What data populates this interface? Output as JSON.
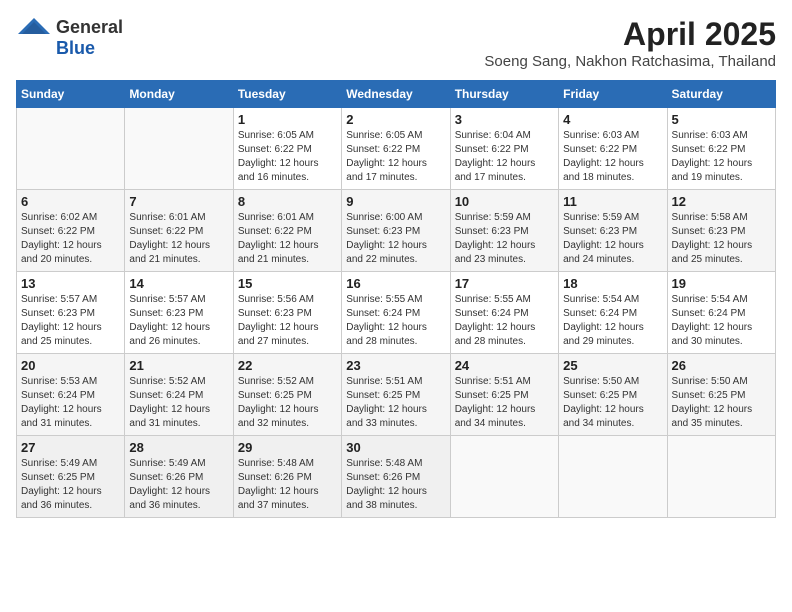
{
  "header": {
    "logo_general": "General",
    "logo_blue": "Blue",
    "month": "April 2025",
    "location": "Soeng Sang, Nakhon Ratchasima, Thailand"
  },
  "weekdays": [
    "Sunday",
    "Monday",
    "Tuesday",
    "Wednesday",
    "Thursday",
    "Friday",
    "Saturday"
  ],
  "weeks": [
    [
      {
        "day": "",
        "info": ""
      },
      {
        "day": "",
        "info": ""
      },
      {
        "day": "1",
        "info": "Sunrise: 6:05 AM\nSunset: 6:22 PM\nDaylight: 12 hours and 16 minutes."
      },
      {
        "day": "2",
        "info": "Sunrise: 6:05 AM\nSunset: 6:22 PM\nDaylight: 12 hours and 17 minutes."
      },
      {
        "day": "3",
        "info": "Sunrise: 6:04 AM\nSunset: 6:22 PM\nDaylight: 12 hours and 17 minutes."
      },
      {
        "day": "4",
        "info": "Sunrise: 6:03 AM\nSunset: 6:22 PM\nDaylight: 12 hours and 18 minutes."
      },
      {
        "day": "5",
        "info": "Sunrise: 6:03 AM\nSunset: 6:22 PM\nDaylight: 12 hours and 19 minutes."
      }
    ],
    [
      {
        "day": "6",
        "info": "Sunrise: 6:02 AM\nSunset: 6:22 PM\nDaylight: 12 hours and 20 minutes."
      },
      {
        "day": "7",
        "info": "Sunrise: 6:01 AM\nSunset: 6:22 PM\nDaylight: 12 hours and 21 minutes."
      },
      {
        "day": "8",
        "info": "Sunrise: 6:01 AM\nSunset: 6:22 PM\nDaylight: 12 hours and 21 minutes."
      },
      {
        "day": "9",
        "info": "Sunrise: 6:00 AM\nSunset: 6:23 PM\nDaylight: 12 hours and 22 minutes."
      },
      {
        "day": "10",
        "info": "Sunrise: 5:59 AM\nSunset: 6:23 PM\nDaylight: 12 hours and 23 minutes."
      },
      {
        "day": "11",
        "info": "Sunrise: 5:59 AM\nSunset: 6:23 PM\nDaylight: 12 hours and 24 minutes."
      },
      {
        "day": "12",
        "info": "Sunrise: 5:58 AM\nSunset: 6:23 PM\nDaylight: 12 hours and 25 minutes."
      }
    ],
    [
      {
        "day": "13",
        "info": "Sunrise: 5:57 AM\nSunset: 6:23 PM\nDaylight: 12 hours and 25 minutes."
      },
      {
        "day": "14",
        "info": "Sunrise: 5:57 AM\nSunset: 6:23 PM\nDaylight: 12 hours and 26 minutes."
      },
      {
        "day": "15",
        "info": "Sunrise: 5:56 AM\nSunset: 6:23 PM\nDaylight: 12 hours and 27 minutes."
      },
      {
        "day": "16",
        "info": "Sunrise: 5:55 AM\nSunset: 6:24 PM\nDaylight: 12 hours and 28 minutes."
      },
      {
        "day": "17",
        "info": "Sunrise: 5:55 AM\nSunset: 6:24 PM\nDaylight: 12 hours and 28 minutes."
      },
      {
        "day": "18",
        "info": "Sunrise: 5:54 AM\nSunset: 6:24 PM\nDaylight: 12 hours and 29 minutes."
      },
      {
        "day": "19",
        "info": "Sunrise: 5:54 AM\nSunset: 6:24 PM\nDaylight: 12 hours and 30 minutes."
      }
    ],
    [
      {
        "day": "20",
        "info": "Sunrise: 5:53 AM\nSunset: 6:24 PM\nDaylight: 12 hours and 31 minutes."
      },
      {
        "day": "21",
        "info": "Sunrise: 5:52 AM\nSunset: 6:24 PM\nDaylight: 12 hours and 31 minutes."
      },
      {
        "day": "22",
        "info": "Sunrise: 5:52 AM\nSunset: 6:25 PM\nDaylight: 12 hours and 32 minutes."
      },
      {
        "day": "23",
        "info": "Sunrise: 5:51 AM\nSunset: 6:25 PM\nDaylight: 12 hours and 33 minutes."
      },
      {
        "day": "24",
        "info": "Sunrise: 5:51 AM\nSunset: 6:25 PM\nDaylight: 12 hours and 34 minutes."
      },
      {
        "day": "25",
        "info": "Sunrise: 5:50 AM\nSunset: 6:25 PM\nDaylight: 12 hours and 34 minutes."
      },
      {
        "day": "26",
        "info": "Sunrise: 5:50 AM\nSunset: 6:25 PM\nDaylight: 12 hours and 35 minutes."
      }
    ],
    [
      {
        "day": "27",
        "info": "Sunrise: 5:49 AM\nSunset: 6:25 PM\nDaylight: 12 hours and 36 minutes."
      },
      {
        "day": "28",
        "info": "Sunrise: 5:49 AM\nSunset: 6:26 PM\nDaylight: 12 hours and 36 minutes."
      },
      {
        "day": "29",
        "info": "Sunrise: 5:48 AM\nSunset: 6:26 PM\nDaylight: 12 hours and 37 minutes."
      },
      {
        "day": "30",
        "info": "Sunrise: 5:48 AM\nSunset: 6:26 PM\nDaylight: 12 hours and 38 minutes."
      },
      {
        "day": "",
        "info": ""
      },
      {
        "day": "",
        "info": ""
      },
      {
        "day": "",
        "info": ""
      }
    ]
  ]
}
